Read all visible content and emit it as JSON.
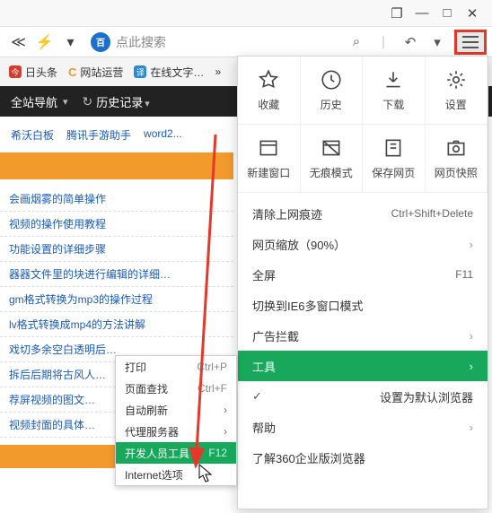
{
  "titlebar": {
    "win": "❐",
    "min": "—",
    "max": "□",
    "close": "✕"
  },
  "toprow": {
    "share": "≪",
    "bolt": "⚡",
    "carrot": "▾",
    "paw": "百",
    "search_placeholder": "点此搜索",
    "search_icon": "⌕",
    "sep": "|",
    "back": "↶",
    "back_caret": "▾"
  },
  "tabs": [
    {
      "fav": "今",
      "favclass": "fav-red",
      "label": "日头条"
    },
    {
      "fav": "C",
      "favclass": "fav-c",
      "label": "网站运营"
    },
    {
      "fav": "译",
      "favclass": "fav-blue",
      "label": "在线文字…"
    }
  ],
  "tabs_more": "»",
  "darkbar": {
    "nav": "全站导航",
    "history": "历史记录",
    "histicon": "↻"
  },
  "quicklinks": [
    "希沃白板",
    "腾讯手游助手",
    "word2..."
  ],
  "list": [
    "会画烟雾的简单操作",
    "视频的操作使用教程",
    "功能设置的详细步骤",
    "器器文件里的块进行编辑的详细…",
    "gm格式转换为mp3的操作过程",
    "lv格式转换成mp4的方法讲解",
    "戏切多余空白透明后…",
    "拆后后期将古风人…",
    "荐屏视频的图文…",
    "视频封面的具体…"
  ],
  "submenu": [
    {
      "label": "打印",
      "shortcut": "Ctrl+P"
    },
    {
      "label": "页面查找",
      "shortcut": "Ctrl+F"
    },
    {
      "label": "自动刷新",
      "hassub": true
    },
    {
      "label": "代理服务器",
      "hassub": true
    },
    {
      "label": "开发人员工具",
      "shortcut": "F12",
      "hl": true
    },
    {
      "label": "Internet选项"
    }
  ],
  "mainmenu": {
    "icons": [
      {
        "label": "收藏",
        "name": "favorite-icon"
      },
      {
        "label": "历史",
        "name": "history-icon"
      },
      {
        "label": "下载",
        "name": "download-icon"
      },
      {
        "label": "设置",
        "name": "settings-icon"
      },
      {
        "label": "新建窗口",
        "name": "newwindow-icon"
      },
      {
        "label": "无痕模式",
        "name": "incognito-icon"
      },
      {
        "label": "保存网页",
        "name": "savepage-icon"
      },
      {
        "label": "网页快照",
        "name": "snapshot-icon"
      }
    ],
    "rows": [
      {
        "label": "清除上网痕迹",
        "shortcut": "Ctrl+Shift+Delete"
      },
      {
        "label": "网页缩放（90%）",
        "sub": true
      },
      {
        "label": "全屏",
        "shortcut": "F11"
      },
      {
        "label": "切换到IE6多窗口模式"
      },
      {
        "label": "广告拦截",
        "sub": true
      },
      {
        "label": "工具",
        "hl": true,
        "sub": true
      },
      {
        "label": "设置为默认浏览器",
        "check": true
      },
      {
        "label": "帮助",
        "sub": true
      },
      {
        "label": "了解360企业版浏览器"
      }
    ]
  }
}
